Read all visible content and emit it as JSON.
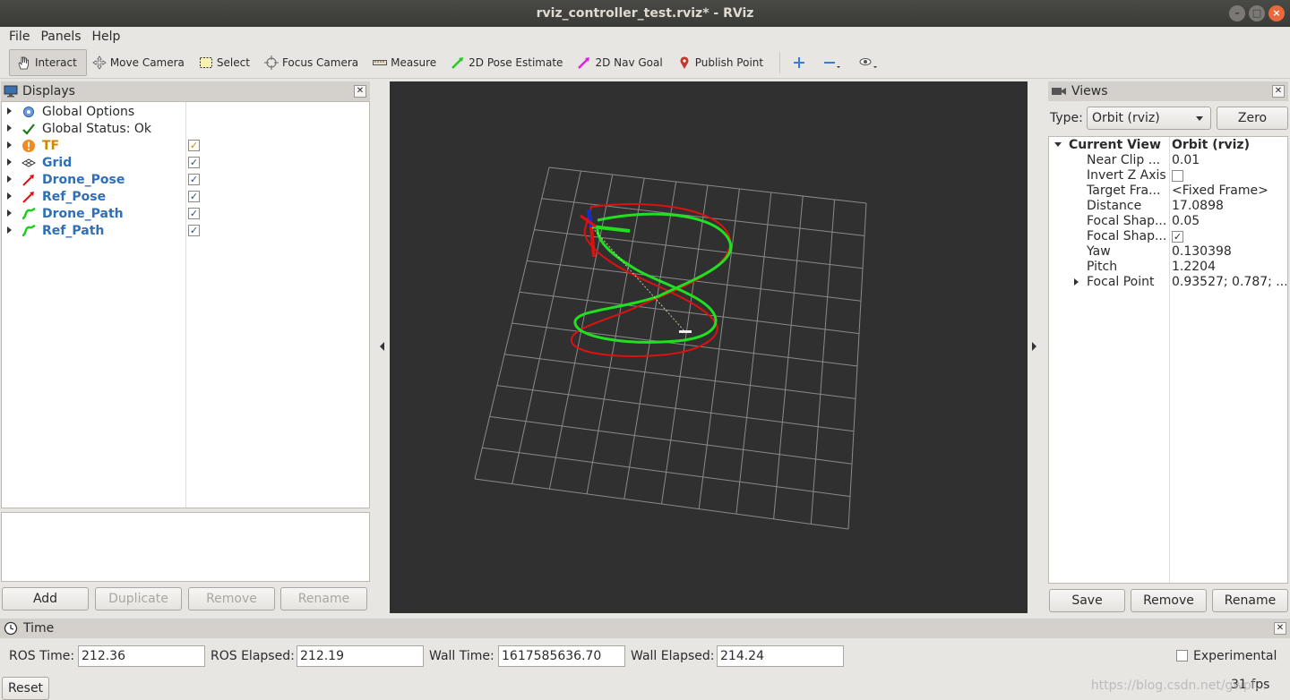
{
  "window": {
    "title": "rviz_controller_test.rviz* - RViz"
  },
  "menu": [
    "File",
    "Panels",
    "Help"
  ],
  "toolbar": {
    "interact": "Interact",
    "move_camera": "Move Camera",
    "select": "Select",
    "focus_camera": "Focus Camera",
    "measure": "Measure",
    "pose_estimate": "2D Pose Estimate",
    "nav_goal": "2D Nav Goal",
    "publish_point": "Publish Point"
  },
  "displays": {
    "title": "Displays",
    "items": [
      {
        "label": "Global Options",
        "style": "normal",
        "checked": null,
        "icon": "gear-icon"
      },
      {
        "label": "Global Status: Ok",
        "style": "normal",
        "checked": null,
        "icon": "check-icon"
      },
      {
        "label": "TF",
        "style": "orange",
        "checked": true,
        "icon": "tf-warning-icon"
      },
      {
        "label": "Grid",
        "style": "blue",
        "checked": true,
        "icon": "grid-icon"
      },
      {
        "label": "Drone_Pose",
        "style": "blue",
        "checked": true,
        "icon": "pose-arrow-icon"
      },
      {
        "label": "Ref_Pose",
        "style": "blue",
        "checked": true,
        "icon": "pose-arrow-icon"
      },
      {
        "label": "Drone_Path",
        "style": "blue",
        "checked": true,
        "icon": "path-icon"
      },
      {
        "label": "Ref_Path",
        "style": "blue",
        "checked": true,
        "icon": "path-icon"
      }
    ],
    "buttons": {
      "add": "Add",
      "duplicate": "Duplicate",
      "remove": "Remove",
      "rename": "Rename"
    }
  },
  "views": {
    "title": "Views",
    "type_label": "Type:",
    "type_value": "Orbit (rviz)",
    "zero": "Zero",
    "current_view": "Current View",
    "current_view_value": "Orbit (rviz)",
    "props": [
      {
        "key": "Near Clip ...",
        "value": "0.01"
      },
      {
        "key": "Invert Z Axis",
        "value": ""
      },
      {
        "key": "Target Fra...",
        "value": "<Fixed Frame>"
      },
      {
        "key": "Distance",
        "value": "17.0898"
      },
      {
        "key": "Focal Shap...",
        "value": "0.05"
      },
      {
        "key": "Focal Shap...",
        "value": ""
      },
      {
        "key": "Yaw",
        "value": "0.130398"
      },
      {
        "key": "Pitch",
        "value": "1.2204"
      },
      {
        "key": "Focal Point",
        "value": "0.93527; 0.787; ..."
      }
    ],
    "buttons": {
      "save": "Save",
      "remove": "Remove",
      "rename": "Rename"
    }
  },
  "time": {
    "title": "Time",
    "ros_time_label": "ROS Time:",
    "ros_time": "212.36",
    "ros_elapsed_label": "ROS Elapsed:",
    "ros_elapsed": "212.19",
    "wall_time_label": "Wall Time:",
    "wall_time": "1617585636.70",
    "wall_elapsed_label": "Wall Elapsed:",
    "wall_elapsed": "214.24",
    "experimental": "Experimental",
    "reset": "Reset",
    "fps": "31 fps"
  },
  "watermark": "https://blog.csdn.net/gwpl..."
}
